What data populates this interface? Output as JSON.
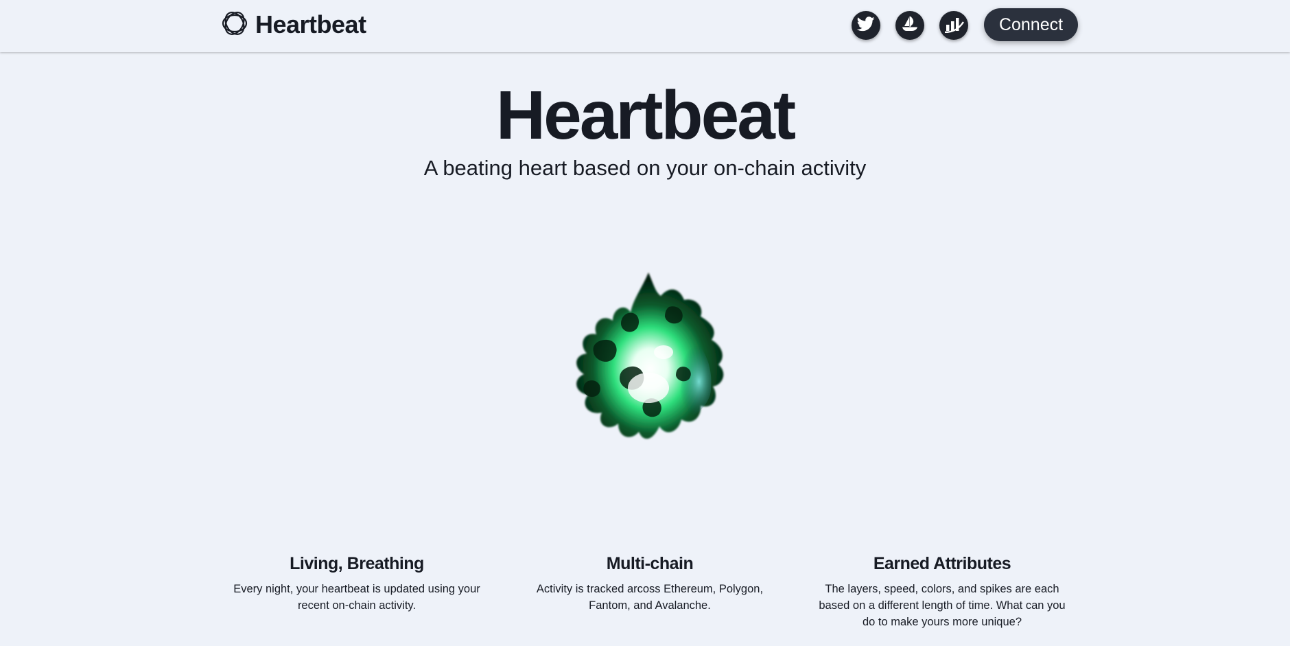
{
  "header": {
    "brand_name": "Heartbeat",
    "connect_label": "Connect",
    "social_icons": [
      "twitter-icon",
      "opensea-icon",
      "analytics-icon"
    ]
  },
  "hero": {
    "title": "Heartbeat",
    "subtitle": "A beating heart based on your on-chain activity"
  },
  "features": [
    {
      "title": "Living, Breathing",
      "description": "Every night, your heartbeat is updated using your recent on-chain activity."
    },
    {
      "title": "Multi-chain",
      "description": "Activity is tracked arcoss Ethereum, Polygon, Fantom, and Avalanche."
    },
    {
      "title": "Earned Attributes",
      "description": "The layers, speed, colors, and spikes are each based on a different length of time. What can you do to make yours more unique?"
    }
  ],
  "colors": {
    "background": "#eef2f9",
    "text": "#171b24",
    "button": "#2b313d",
    "blob_green": "#1fe07a",
    "blob_teal": "#3ec6c0"
  }
}
